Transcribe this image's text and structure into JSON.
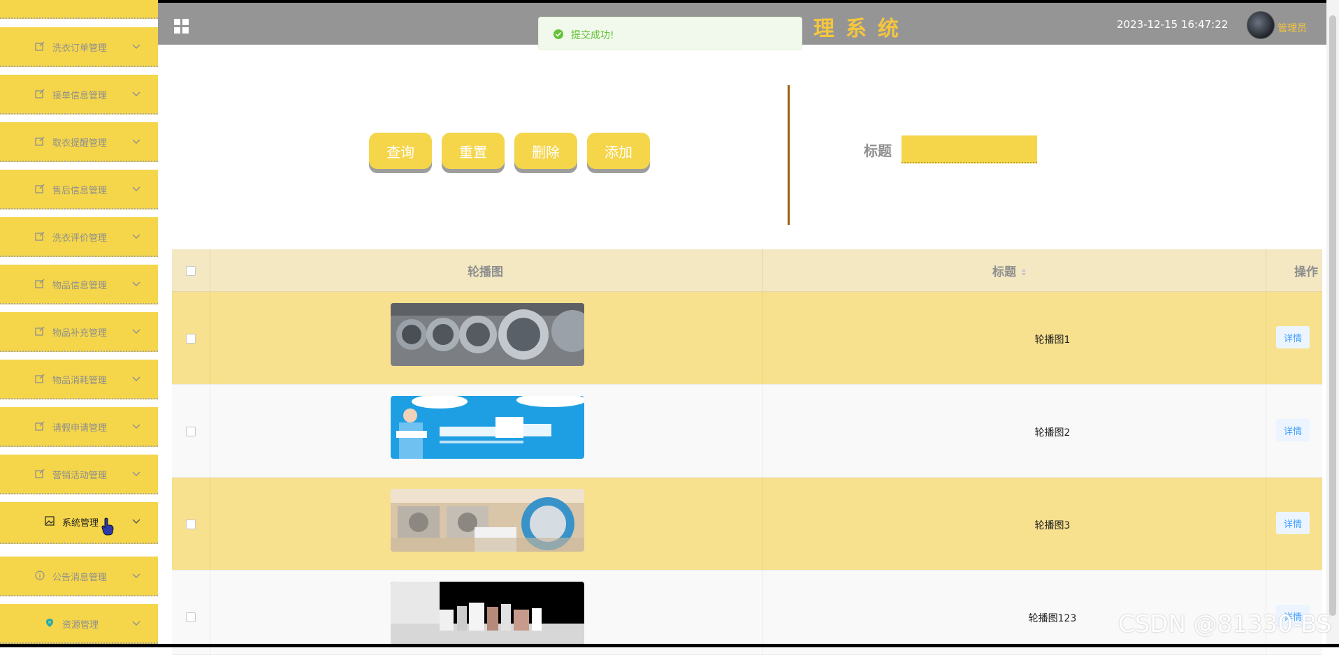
{
  "header": {
    "title": "欢迎使用洗衣店管理系统",
    "datetime": "2023-12-15 16:47:22",
    "user": "管理员"
  },
  "toast": {
    "message": "提交成功!"
  },
  "sidebar": {
    "items": [
      {
        "label": "洗衣订单管理",
        "icon": "edit-icon"
      },
      {
        "label": "接单信息管理",
        "icon": "edit-icon"
      },
      {
        "label": "取衣提醒管理",
        "icon": "edit-icon"
      },
      {
        "label": "售后信息管理",
        "icon": "edit-icon"
      },
      {
        "label": "洗衣评价管理",
        "icon": "edit-icon"
      },
      {
        "label": "物品信息管理",
        "icon": "edit-icon"
      },
      {
        "label": "物品补充管理",
        "icon": "edit-icon"
      },
      {
        "label": "物品消耗管理",
        "icon": "edit-icon"
      },
      {
        "label": "请假申请管理",
        "icon": "edit-icon"
      },
      {
        "label": "营销活动管理",
        "icon": "edit-icon"
      },
      {
        "label": "系统管理",
        "icon": "picture-icon"
      },
      {
        "label": "公告消息管理",
        "icon": "info-icon"
      },
      {
        "label": "资源管理",
        "icon": "location-icon"
      }
    ]
  },
  "toolbar": {
    "query": "查询",
    "reset": "重置",
    "delete": "删除",
    "add": "添加"
  },
  "search": {
    "label": "标题",
    "value": ""
  },
  "table": {
    "headers": {
      "image": "轮播图",
      "title": "标题",
      "action": "操作"
    },
    "rows": [
      {
        "title": "轮播图1",
        "action": "详情"
      },
      {
        "title": "轮播图2",
        "action": "详情"
      },
      {
        "title": "轮播图3",
        "action": "详情"
      },
      {
        "title": "轮播图123",
        "action": "详情"
      }
    ]
  },
  "watermark": "CSDN @81330-BS",
  "colors": {
    "accent": "#f5d54a",
    "header": "#959595",
    "title": "#f6c63d"
  }
}
